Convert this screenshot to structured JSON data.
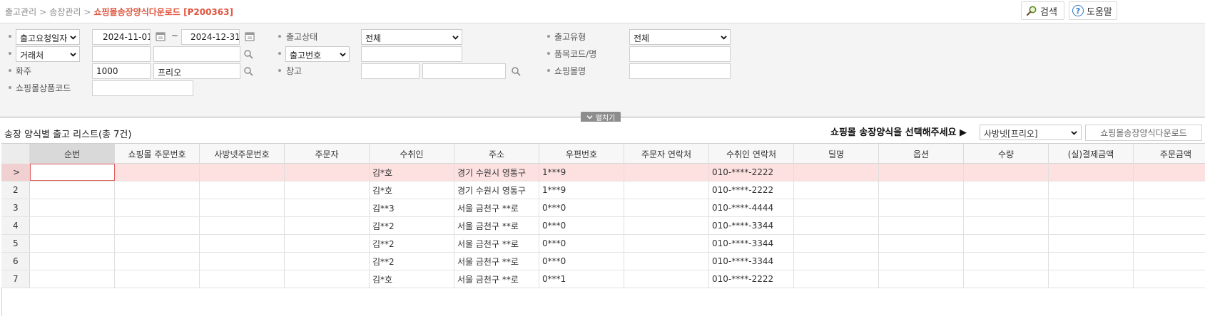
{
  "breadcrumb": {
    "item1": "출고관리",
    "item2": "송장관리",
    "current": "쇼핑몰송장양식다운로드 [P200363]",
    "separator": ">"
  },
  "top_buttons": {
    "search": "검색",
    "help": "도움말",
    "help_glyph": "?"
  },
  "filters": {
    "row1": {
      "date_type": "출고요청일자",
      "date_from": "2024-11-01",
      "date_tilde": "~",
      "date_to": "2024-12-31",
      "ship_status_label": "출고상태",
      "ship_status_value": "전체",
      "ship_type_label": "출고유형",
      "ship_type_value": "전체"
    },
    "row2": {
      "partner_type": "거래처",
      "partner_code": "",
      "partner_name": "",
      "number_type": "출고번호",
      "number_value": "",
      "item_label": "품목코드/명",
      "item_value": ""
    },
    "row3": {
      "owner_label": "화주",
      "owner_code": "1000",
      "owner_name": "프리오",
      "warehouse_label": "창고",
      "warehouse_code": "",
      "warehouse_name": "",
      "mall_label": "쇼핑몰명",
      "mall_value": ""
    },
    "row4": {
      "mall_product_label": "쇼핑몰상품코드",
      "mall_product_value": ""
    },
    "expand_label": "펼치기"
  },
  "list": {
    "title": "송장 양식별 출고 리스트(총 7건)",
    "format_prompt": "쇼핑몰 송장양식을 선택해주세요 ▶",
    "format_value": "사방넷[프리오]",
    "download_button": "쇼핑몰송장양식다운로드"
  },
  "grid": {
    "columns": [
      "",
      "순번",
      "쇼핑몰 주문번호",
      "사방넷주문번호",
      "주문자",
      "수취인",
      "주소",
      "우편번호",
      "주문자 연락처",
      "수취인 연락처",
      "딜명",
      "옵션",
      "수량",
      "(실)결제금액",
      "주문금액"
    ],
    "rows": [
      {
        "idx": ">",
        "seq": "",
        "mall_order": "",
        "sabang_order": "",
        "orderer": "",
        "receiver": "김*호",
        "address": "경기 수원시 영통구",
        "zip": "1***9",
        "orderer_tel": "",
        "receiver_tel": "010-****-2222",
        "deal": "",
        "option": "",
        "qty": "",
        "paid": "",
        "amount": ""
      },
      {
        "idx": "2",
        "seq": "",
        "mall_order": "",
        "sabang_order": "",
        "orderer": "",
        "receiver": "김*호",
        "address": "경기 수원시 영통구",
        "zip": "1***9",
        "orderer_tel": "",
        "receiver_tel": "010-****-2222",
        "deal": "",
        "option": "",
        "qty": "",
        "paid": "",
        "amount": ""
      },
      {
        "idx": "3",
        "seq": "",
        "mall_order": "",
        "sabang_order": "",
        "orderer": "",
        "receiver": "김**3",
        "address": "서울 금천구 **로",
        "zip": "0***0",
        "orderer_tel": "",
        "receiver_tel": "010-****-4444",
        "deal": "",
        "option": "",
        "qty": "",
        "paid": "",
        "amount": ""
      },
      {
        "idx": "4",
        "seq": "",
        "mall_order": "",
        "sabang_order": "",
        "orderer": "",
        "receiver": "김**2",
        "address": "서울 금천구 **로",
        "zip": "0***0",
        "orderer_tel": "",
        "receiver_tel": "010-****-3344",
        "deal": "",
        "option": "",
        "qty": "",
        "paid": "",
        "amount": ""
      },
      {
        "idx": "5",
        "seq": "",
        "mall_order": "",
        "sabang_order": "",
        "orderer": "",
        "receiver": "김**2",
        "address": "서울 금천구 **로",
        "zip": "0***0",
        "orderer_tel": "",
        "receiver_tel": "010-****-3344",
        "deal": "",
        "option": "",
        "qty": "",
        "paid": "",
        "amount": ""
      },
      {
        "idx": "6",
        "seq": "",
        "mall_order": "",
        "sabang_order": "",
        "orderer": "",
        "receiver": "김**2",
        "address": "서울 금천구 **로",
        "zip": "0***0",
        "orderer_tel": "",
        "receiver_tel": "010-****-3344",
        "deal": "",
        "option": "",
        "qty": "",
        "paid": "",
        "amount": ""
      },
      {
        "idx": "7",
        "seq": "",
        "mall_order": "",
        "sabang_order": "",
        "orderer": "",
        "receiver": "김*호",
        "address": "서울 금천구 **로",
        "zip": "0***1",
        "orderer_tel": "",
        "receiver_tel": "010-****-2222",
        "deal": "",
        "option": "",
        "qty": "",
        "paid": "",
        "amount": ""
      }
    ]
  },
  "icons": {
    "search": "magnifier-icon",
    "help": "question-circle-icon",
    "calendar": "calendar-icon",
    "dropdown": "chevron-down-icon"
  },
  "colors": {
    "breadcrumb_current": "#e0553d",
    "selected_row": "#fde0e0",
    "help_blue": "#2f77c9"
  }
}
